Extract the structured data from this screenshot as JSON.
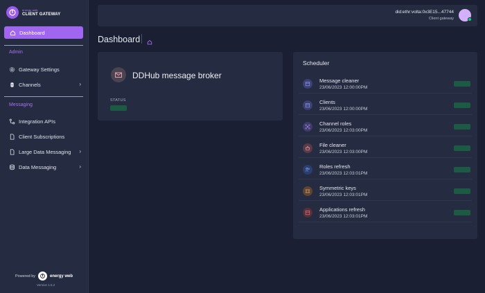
{
  "brand": {
    "small": "energy web",
    "main": "CLIENT GATEWAY"
  },
  "sidebar": {
    "dashboard": "Dashboard",
    "admin_section": "Admin",
    "admin_items": [
      {
        "label": "Gateway Settings",
        "icon": "gear-icon"
      },
      {
        "label": "Channels",
        "icon": "command-icon",
        "chevron": true
      }
    ],
    "messaging_section": "Messaging",
    "messaging_items": [
      {
        "label": "Integration APIs",
        "icon": "integration-icon"
      },
      {
        "label": "Client Subscriptions",
        "icon": "document-icon"
      },
      {
        "label": "Large Data Messaging",
        "icon": "document-icon",
        "chevron": true
      },
      {
        "label": "Data Messaging",
        "icon": "database-icon",
        "chevron": true
      }
    ],
    "powered_by": "Powered by",
    "powered_brand": "energy web",
    "version": "Version 1.5.2"
  },
  "header": {
    "did": "did:ethr:volta:0x3E15...47744",
    "role": "Client gateway"
  },
  "page": {
    "title": "Dashboard"
  },
  "broker": {
    "title": "DDHub message broker",
    "status_label": "STATUS",
    "status_badge": ""
  },
  "scheduler": {
    "title": "Scheduler",
    "items": [
      {
        "name": "Message cleaner",
        "time": "23/06/2023 12:00:00PM",
        "badge": "",
        "color": "#3b3f72"
      },
      {
        "name": "Clients",
        "time": "23/06/2023 12:00:00PM",
        "badge": "",
        "color": "#3b3f72"
      },
      {
        "name": "Channel roles",
        "time": "23/06/2023 12:03:00PM",
        "badge": "",
        "color": "#403a6a"
      },
      {
        "name": "File cleaner",
        "time": "23/06/2023 12:03:00PM",
        "badge": "",
        "color": "#5a3a48"
      },
      {
        "name": "Roles refresh",
        "time": "23/06/2023 12:03:01PM",
        "badge": "",
        "color": "#2c3d6e"
      },
      {
        "name": "Symmetric keys",
        "time": "23/06/2023 12:03:01PM",
        "badge": "",
        "color": "#5e4433"
      },
      {
        "name": "Applications refresh",
        "time": "23/06/2023 12:03:01PM",
        "badge": "",
        "color": "#552f39"
      }
    ]
  },
  "colors": {
    "accent": "#a166f0",
    "success": "#2fd08a",
    "panel": "#252c41",
    "background": "#1a1f33"
  }
}
